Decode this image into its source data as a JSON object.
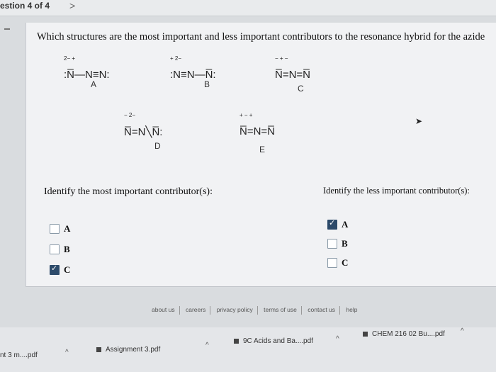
{
  "header": {
    "question_counter": "estion 4 of 4",
    "next_label": ">"
  },
  "question": {
    "text": "Which structures are the most important and less important contributors to the resonance hybrid for the azide"
  },
  "structures": [
    {
      "label": "A",
      "formula": ":N̅—N≡N:",
      "charges": "2−  +"
    },
    {
      "label": "B",
      "formula": ":N≡N—N̅:",
      "charges": "+  2−"
    },
    {
      "label": "C",
      "formula": "N̅=N=N̅",
      "charges": "−  +  −"
    },
    {
      "label": "D",
      "formula": "N̅=N╲N̅:",
      "charges": "−  2−"
    },
    {
      "label": "E",
      "formula": "N̅=N=N̅",
      "charges": "+  −  +"
    }
  ],
  "most_important": {
    "prompt": "Identify the most important contributor(s):",
    "options": [
      {
        "label": "A",
        "checked": false
      },
      {
        "label": "B",
        "checked": false
      },
      {
        "label": "C",
        "checked": true
      }
    ]
  },
  "less_important": {
    "prompt": "Identify the less important contributor(s):",
    "options": [
      {
        "label": "A",
        "checked": true
      },
      {
        "label": "B",
        "checked": false
      },
      {
        "label": "C",
        "checked": false
      }
    ]
  },
  "footer_links": [
    "about us",
    "careers",
    "privacy policy",
    "terms of use",
    "contact us",
    "help"
  ],
  "downloads": [
    {
      "name": "nt 3 m....pdf"
    },
    {
      "name": "Assignment 3.pdf"
    },
    {
      "name": "9C Acids and Ba....pdf"
    },
    {
      "name": "CHEM 216 02 Bu....pdf"
    }
  ],
  "colors": {
    "checkbox_checked": "#2c4a6a",
    "card_bg": "#f1f2f4"
  }
}
